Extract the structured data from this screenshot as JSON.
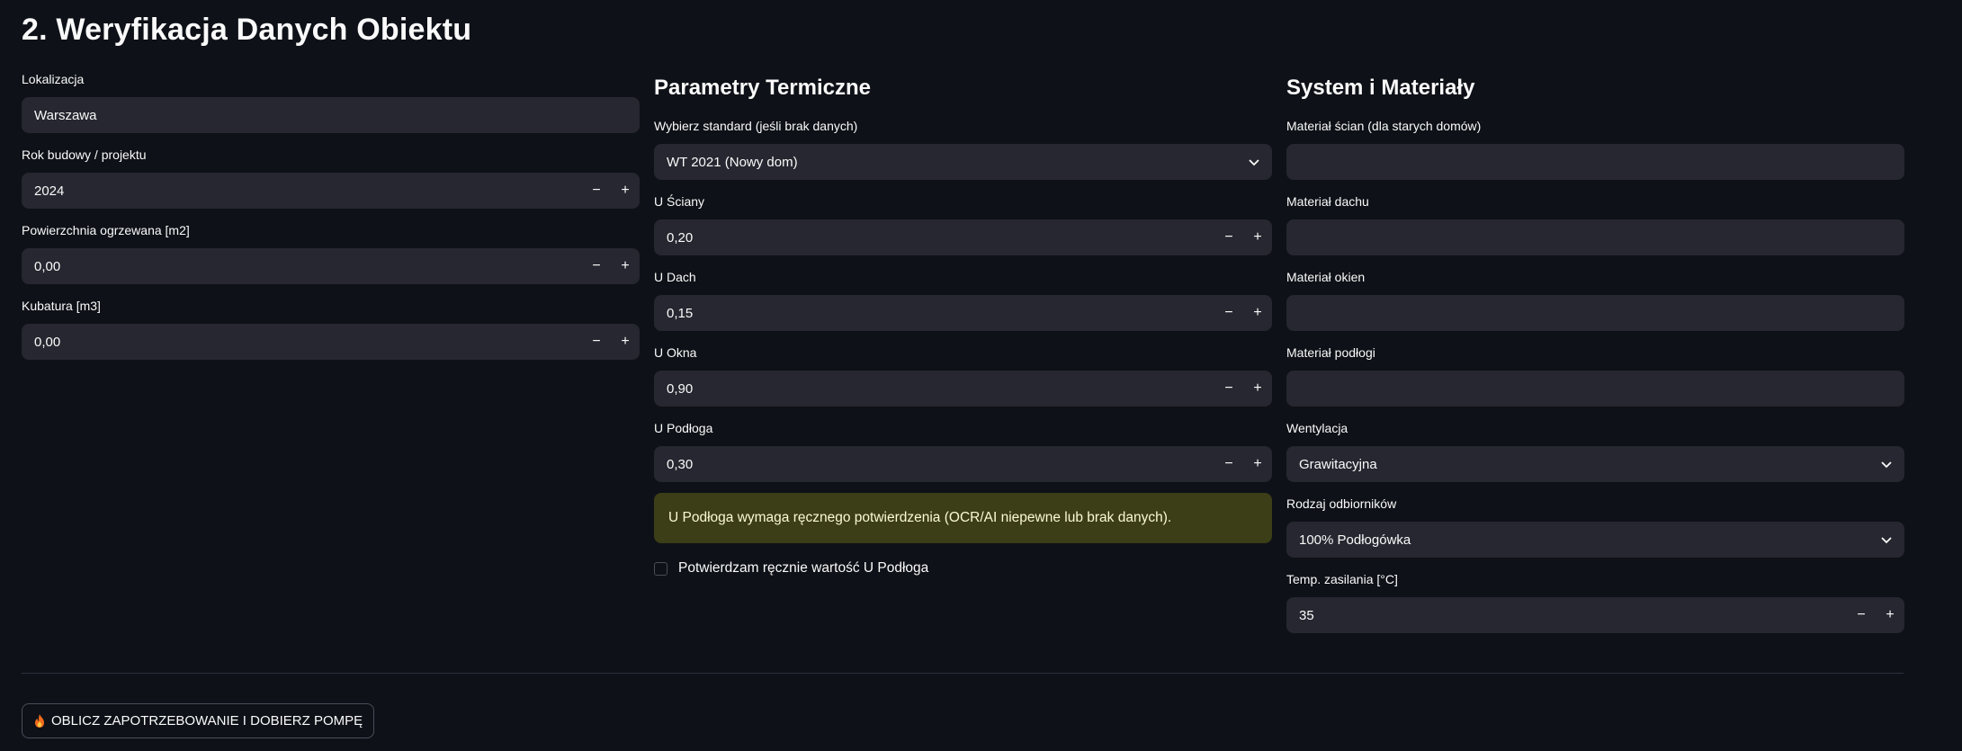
{
  "title": "2. Weryfikacja Danych Obiektu",
  "col1": {
    "fields": [
      {
        "label": "Lokalizacja",
        "value": "Warszawa"
      },
      {
        "label": "Rok budowy / projektu",
        "value": "2024"
      },
      {
        "label": "Powierzchnia ogrzewana [m2]",
        "value": "0,00"
      },
      {
        "label": "Kubatura [m3]",
        "value": "0,00"
      }
    ]
  },
  "col2": {
    "heading": "Parametry Termiczne",
    "standard": {
      "label": "Wybierz standard (jeśli brak danych)",
      "value": "WT 2021 (Nowy dom)"
    },
    "fields": [
      {
        "label": "U Ściany",
        "value": "0,20"
      },
      {
        "label": "U Dach",
        "value": "0,15"
      },
      {
        "label": "U Okna",
        "value": "0,90"
      },
      {
        "label": "U Podłoga",
        "value": "0,30"
      }
    ],
    "warning": "U Podłoga wymaga ręcznego potwierdzenia (OCR/AI niepewne lub brak danych).",
    "confirm_label": "Potwierdzam ręcznie wartość U Podłoga"
  },
  "col3": {
    "heading": "System i Materiały",
    "materials": [
      {
        "label": "Materiał ścian (dla starych domów)",
        "value": ""
      },
      {
        "label": "Materiał dachu",
        "value": ""
      },
      {
        "label": "Materiał okien",
        "value": ""
      },
      {
        "label": "Materiał podłogi",
        "value": ""
      }
    ],
    "ventilation": {
      "label": "Wentylacja",
      "value": "Grawitacyjna"
    },
    "receivers": {
      "label": "Rodzaj odbiorników",
      "value": "100% Podłogówka"
    },
    "supply_temp": {
      "label": "Temp. zasilania [°C]",
      "value": "35"
    }
  },
  "stepper": {
    "minus": "−",
    "plus": "+"
  },
  "action_button": "OBLICZ ZAPOTRZEBOWANIE I DOBIERZ POMPĘ",
  "colors": {
    "background": "#0e1117",
    "input": "#262730",
    "warning_bg": "#3b3e17",
    "warning_text": "#fcf9d6"
  }
}
